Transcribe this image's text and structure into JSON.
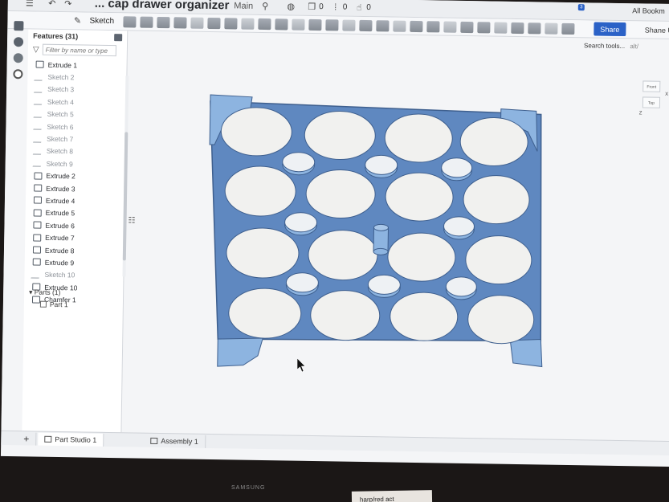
{
  "document": {
    "title": "... cap drawer organizer",
    "branch": "Main"
  },
  "titlebar": {
    "counts": [
      {
        "icon": "copy-icon",
        "value": "0"
      },
      {
        "icon": "pin-icon",
        "value": "0"
      },
      {
        "icon": "thumbs-up-icon",
        "value": "0"
      }
    ],
    "bookmarks": "All Bookm"
  },
  "toolbar": {
    "sketch_label": "Sketch",
    "share_label": "Share",
    "notification_count": "3",
    "search_tools": "Search tools...",
    "search_shortcut": "alt/"
  },
  "user": {
    "name": "Shane Upt"
  },
  "feature_panel": {
    "title": "Features (31)",
    "filter_placeholder": "Filter by name or type",
    "items": [
      {
        "label": "Extrude 1",
        "kind": "extrude"
      },
      {
        "label": "Sketch 2",
        "kind": "sketch"
      },
      {
        "label": "Sketch 3",
        "kind": "sketch"
      },
      {
        "label": "Sketch 4",
        "kind": "sketch"
      },
      {
        "label": "Sketch 5",
        "kind": "sketch"
      },
      {
        "label": "Sketch 6",
        "kind": "sketch"
      },
      {
        "label": "Sketch 7",
        "kind": "sketch"
      },
      {
        "label": "Sketch 8",
        "kind": "sketch"
      },
      {
        "label": "Sketch 9",
        "kind": "sketch"
      },
      {
        "label": "Extrude 2",
        "kind": "extrude"
      },
      {
        "label": "Extrude 3",
        "kind": "extrude"
      },
      {
        "label": "Extrude 4",
        "kind": "extrude"
      },
      {
        "label": "Extrude 5",
        "kind": "extrude"
      },
      {
        "label": "Extrude 6",
        "kind": "extrude"
      },
      {
        "label": "Extrude 7",
        "kind": "extrude"
      },
      {
        "label": "Extrude 8",
        "kind": "extrude"
      },
      {
        "label": "Extrude 9",
        "kind": "extrude"
      },
      {
        "label": "Sketch 10",
        "kind": "sketch"
      },
      {
        "label": "Extrude 10",
        "kind": "extrude"
      },
      {
        "label": "Chamfer 1",
        "kind": "extrude"
      }
    ],
    "parts_header": "Parts (1)",
    "parts": [
      {
        "label": "Part 1"
      }
    ]
  },
  "viewcube": {
    "front": "Front",
    "top": "Top",
    "axis_x": "X",
    "axis_z": "Z"
  },
  "tabs": [
    {
      "label": "Part Studio 1",
      "active": true
    },
    {
      "label": "Assembly 1",
      "active": false
    }
  ],
  "monitor_brand": "SAMSUNG",
  "paper_note": "harp/red act",
  "colors": {
    "model": "#5f88c0",
    "model_dark": "#3e5f8e",
    "hole": "#f1f1ef",
    "accent": "#2b62c7"
  }
}
